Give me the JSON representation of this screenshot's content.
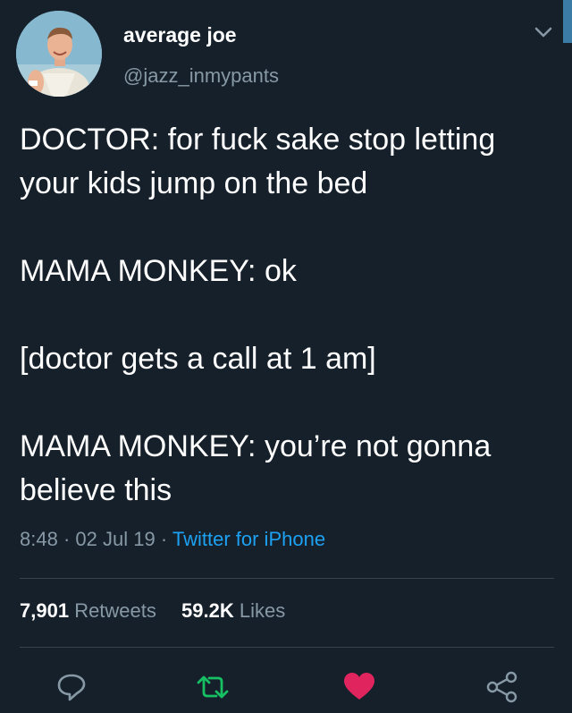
{
  "user": {
    "display_name": "average joe",
    "handle": "@jazz_inmypants"
  },
  "tweet": {
    "lines": [
      "DOCTOR: for fuck sake stop letting your kids jump on the bed",
      "MAMA MONKEY: ok",
      "[doctor gets a call at 1 am]",
      "MAMA MONKEY: you’re not gonna believe this"
    ]
  },
  "meta": {
    "time": "8:48",
    "separator": "·",
    "date": "02 Jul 19",
    "source": "Twitter for iPhone"
  },
  "stats": {
    "retweets_count": "7,901",
    "retweets_label": "Retweets",
    "likes_count": "59.2K",
    "likes_label": "Likes"
  },
  "actions": {
    "reply_icon": "reply-icon",
    "retweet_icon": "retweet-icon",
    "like_icon": "heart-icon",
    "share_icon": "share-icon"
  },
  "colors": {
    "background": "#15202b",
    "secondary_text": "#8899a6",
    "link": "#1da1f2",
    "retweet": "#17bf63",
    "like": "#e0245e"
  }
}
